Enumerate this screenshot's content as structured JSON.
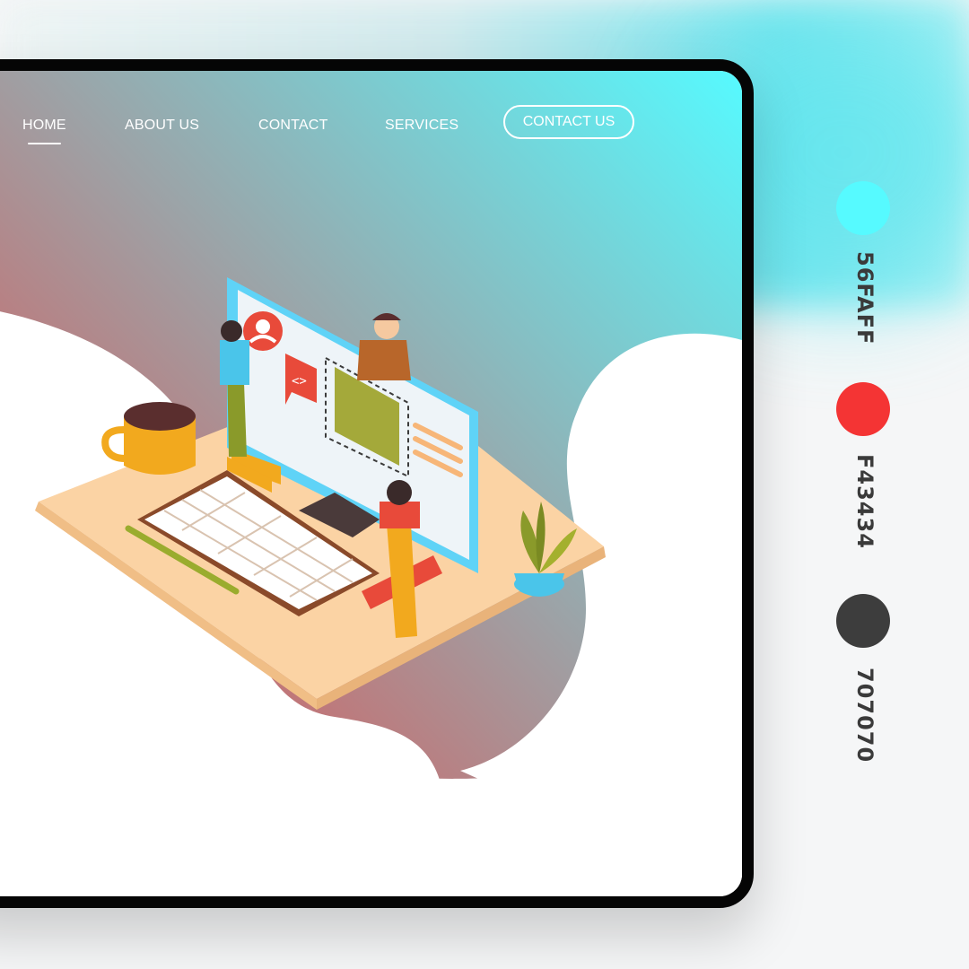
{
  "nav": {
    "items": [
      {
        "label": "HOME",
        "active": true
      },
      {
        "label": "ABOUT US",
        "active": false
      },
      {
        "label": "CONTACT",
        "active": false
      },
      {
        "label": "SERVICES",
        "active": false
      }
    ],
    "cta_label": "CONTACT US"
  },
  "palette": [
    {
      "hex": "#56FAFF",
      "label": "56FAFF"
    },
    {
      "hex": "#F43434",
      "label": "F43434"
    },
    {
      "hex": "#3D3D3D",
      "label": "707070"
    }
  ],
  "colors": {
    "gradient_top": "#56FAFF",
    "gradient_bottom": "#F43434",
    "frame": "#050505"
  },
  "illustration": {
    "icons": [
      "coffee-mug-icon",
      "keyboard-icon",
      "pen-icon",
      "monitor-icon",
      "code-bubble-icon",
      "profile-avatar-icon",
      "plant-icon"
    ]
  }
}
